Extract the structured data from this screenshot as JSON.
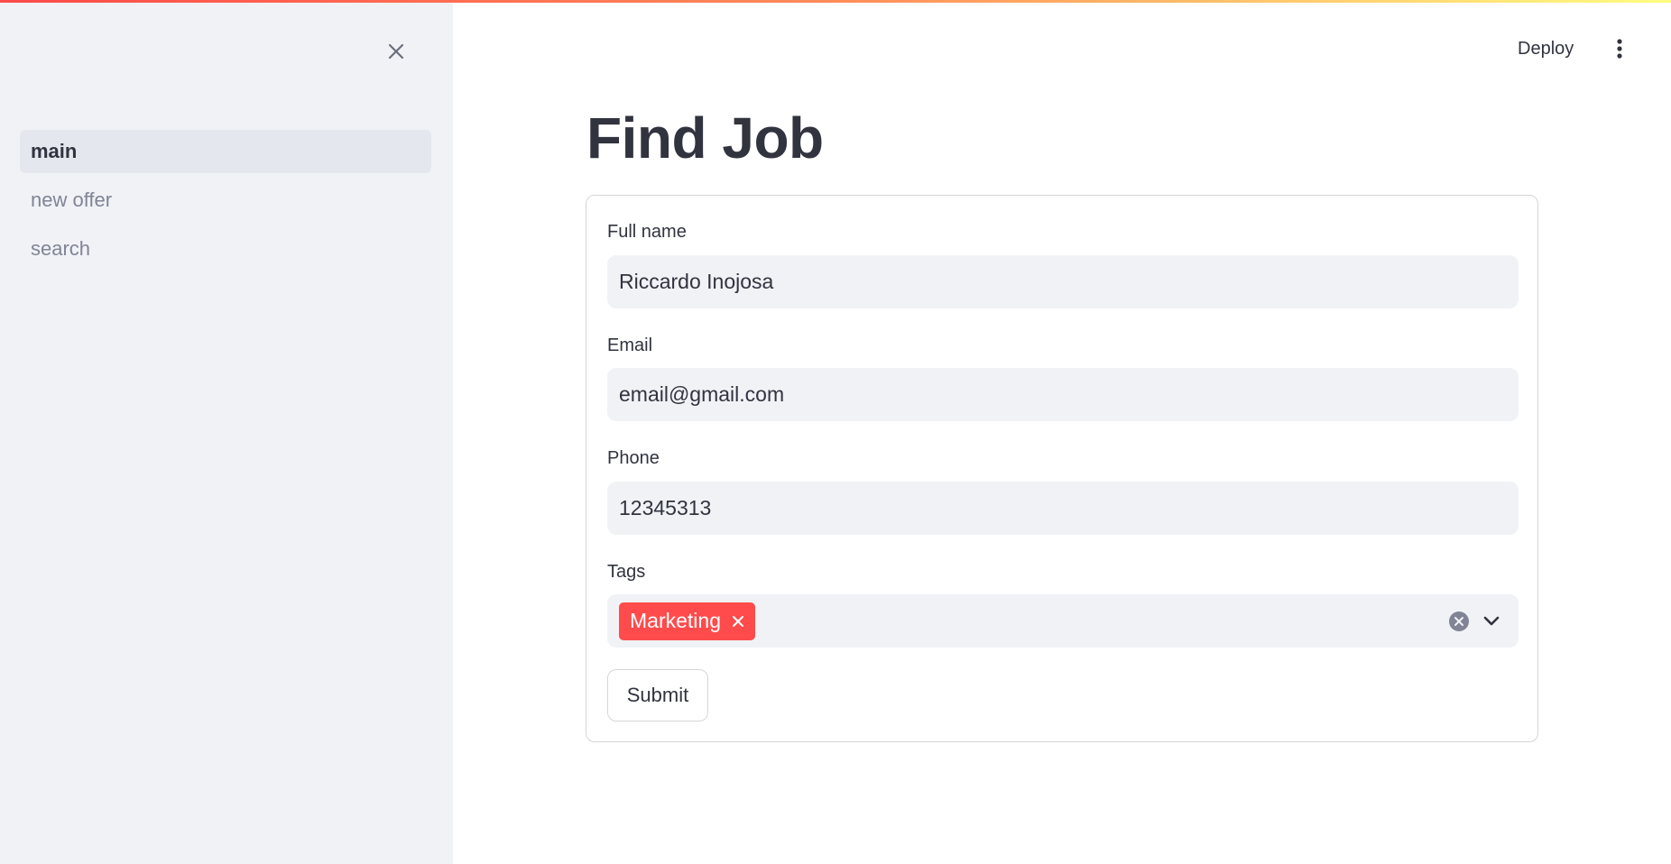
{
  "sidebar": {
    "items": [
      {
        "label": "main"
      },
      {
        "label": "new offer"
      },
      {
        "label": "search"
      }
    ]
  },
  "header": {
    "deploy_label": "Deploy"
  },
  "page": {
    "title": "Find Job"
  },
  "form": {
    "full_name": {
      "label": "Full name",
      "value": "Riccardo Inojosa"
    },
    "email": {
      "label": "Email",
      "value": "email@gmail.com"
    },
    "phone": {
      "label": "Phone",
      "value": "12345313"
    },
    "tags": {
      "label": "Tags",
      "selected": [
        "Marketing"
      ]
    },
    "submit_label": "Submit"
  },
  "colors": {
    "accent": "#ff4b4b",
    "sidebar_bg": "#f0f2f6",
    "text": "#31333f"
  }
}
